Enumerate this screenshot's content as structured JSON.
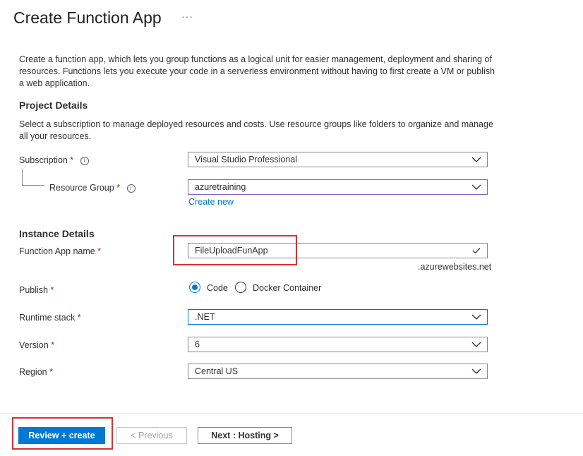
{
  "header": {
    "title": "Create Function App",
    "more_label": "···"
  },
  "intro": "Create a function app, which lets you group functions as a logical unit for easier management, deployment and sharing of resources. Functions lets you execute your code in a serverless environment without having to first create a VM or publish a web application.",
  "project_details": {
    "heading": "Project Details",
    "description": "Select a subscription to manage deployed resources and costs. Use resource groups like folders to organize and manage all your resources.",
    "subscription": {
      "label": "Subscription",
      "required": "*",
      "info": "i",
      "value": "Visual Studio Professional"
    },
    "resource_group": {
      "label": "Resource Group",
      "required": "*",
      "info": "i",
      "value": "azuretraining",
      "create_new": "Create new"
    }
  },
  "instance_details": {
    "heading": "Instance Details",
    "app_name": {
      "label": "Function App name",
      "required": "*",
      "value": "FileUploadFunApp",
      "suffix": ".azurewebsites.net",
      "valid_icon": "check-icon"
    },
    "publish": {
      "label": "Publish",
      "required": "*",
      "options": [
        "Code",
        "Docker Container"
      ],
      "selected": "Code"
    },
    "runtime": {
      "label": "Runtime stack",
      "required": "*",
      "value": ".NET"
    },
    "version": {
      "label": "Version",
      "required": "*",
      "value": "6"
    },
    "region": {
      "label": "Region",
      "required": "*",
      "value": "Central US"
    }
  },
  "footer": {
    "review_create": "Review + create",
    "previous": "< Previous",
    "next": "Next : Hosting >"
  },
  "colors": {
    "accent": "#0078d4",
    "required": "#a4262c",
    "highlight": "#d13438"
  }
}
